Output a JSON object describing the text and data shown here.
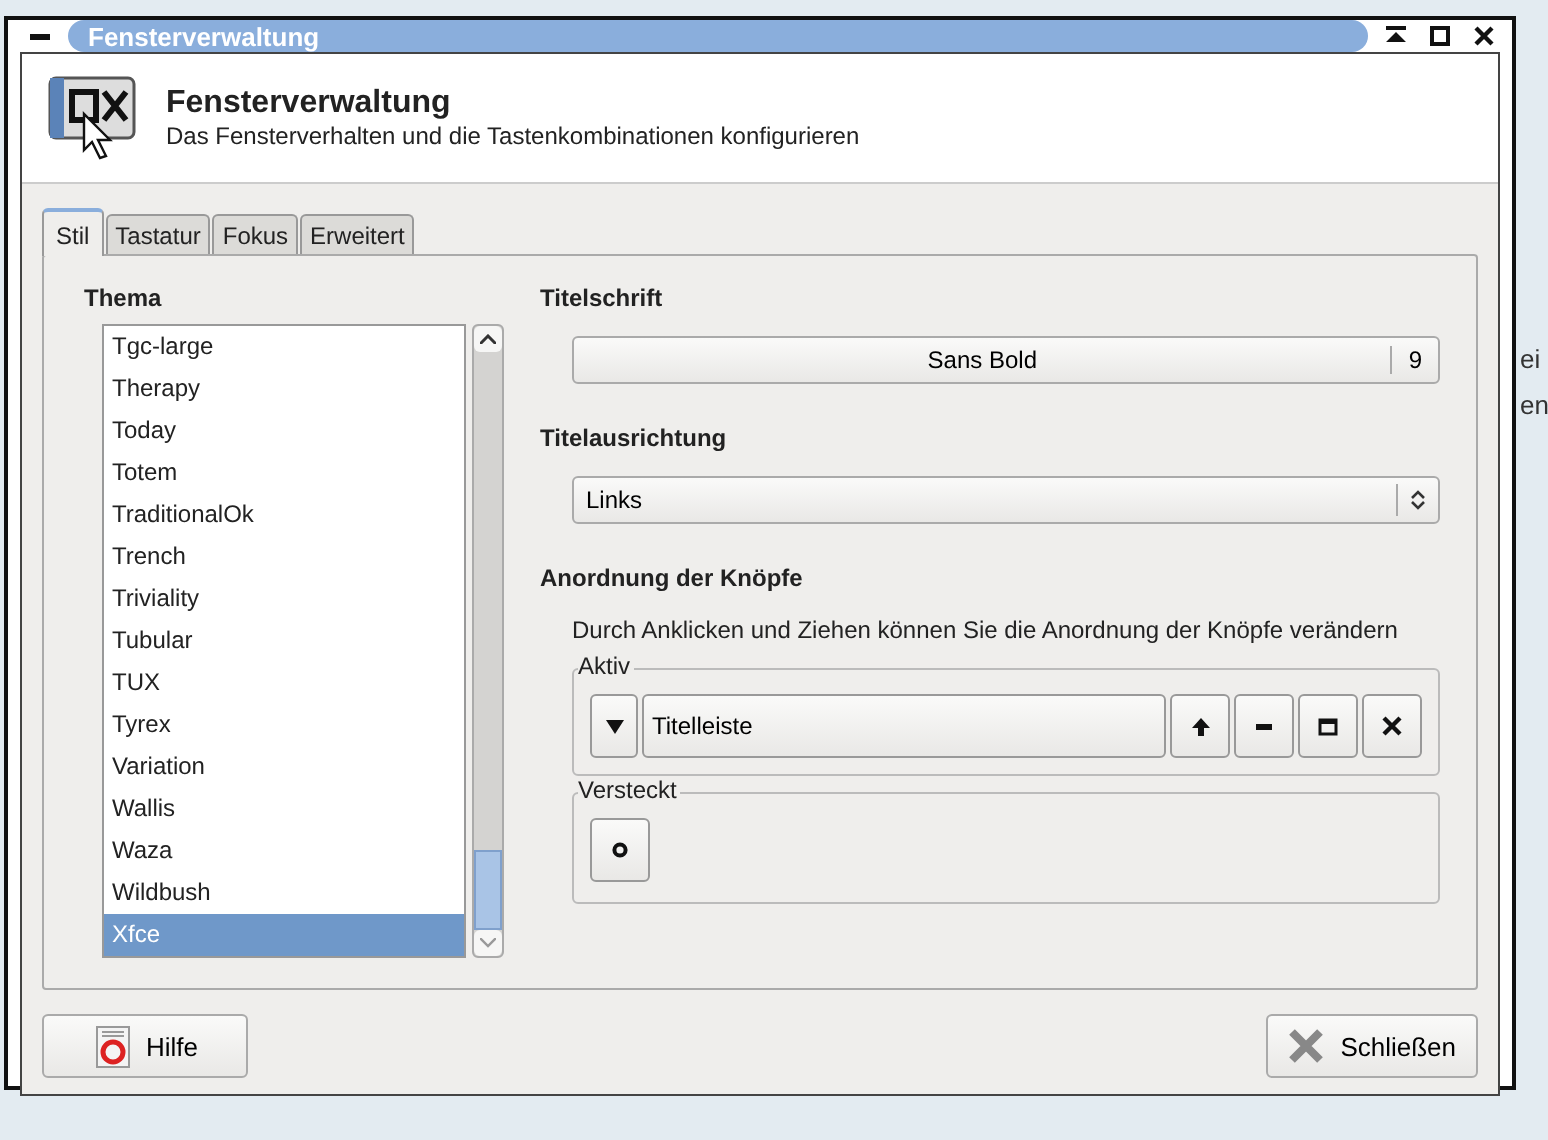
{
  "window": {
    "title": "Fensterverwaltung"
  },
  "header": {
    "title": "Fensterverwaltung",
    "subtitle": "Das Fensterverhalten und die Tastenkombinationen konfigurieren"
  },
  "tabs": [
    {
      "label": "Stil",
      "selected": true
    },
    {
      "label": "Tastatur",
      "selected": false
    },
    {
      "label": "Fokus",
      "selected": false
    },
    {
      "label": "Erweitert",
      "selected": false
    }
  ],
  "theme": {
    "label": "Thema",
    "items": [
      {
        "label": "Tgc-large",
        "selected": false
      },
      {
        "label": "Therapy",
        "selected": false
      },
      {
        "label": "Today",
        "selected": false
      },
      {
        "label": "Totem",
        "selected": false
      },
      {
        "label": "TraditionalOk",
        "selected": false
      },
      {
        "label": "Trench",
        "selected": false
      },
      {
        "label": "Triviality",
        "selected": false
      },
      {
        "label": "Tubular",
        "selected": false
      },
      {
        "label": "TUX",
        "selected": false
      },
      {
        "label": "Tyrex",
        "selected": false
      },
      {
        "label": "Variation",
        "selected": false
      },
      {
        "label": "Wallis",
        "selected": false
      },
      {
        "label": "Waza",
        "selected": false
      },
      {
        "label": "Wildbush",
        "selected": false
      },
      {
        "label": "Xfce",
        "selected": true
      }
    ]
  },
  "title_font": {
    "label": "Titelschrift",
    "font": "Sans Bold",
    "size": "9"
  },
  "title_alignment": {
    "label": "Titelausrichtung",
    "value": "Links"
  },
  "button_layout": {
    "label": "Anordnung der Knöpfe",
    "hint": "Durch Anklicken und Ziehen können Sie die Anordnung der Knöpfe verändern",
    "active": {
      "label": "Aktiv",
      "buttons": [
        {
          "kind": "menu"
        },
        {
          "kind": "title",
          "label": "Titelleiste"
        },
        {
          "kind": "shade"
        },
        {
          "kind": "minimize"
        },
        {
          "kind": "maximize"
        },
        {
          "kind": "close"
        }
      ]
    },
    "hidden": {
      "label": "Versteckt",
      "buttons": [
        {
          "kind": "stick"
        }
      ]
    }
  },
  "buttons": [
    {
      "kind": "help",
      "label": "Hilfe"
    },
    {
      "kind": "close",
      "label": "Schließen"
    }
  ],
  "background": {
    "texts": [
      "ei",
      "en"
    ]
  }
}
